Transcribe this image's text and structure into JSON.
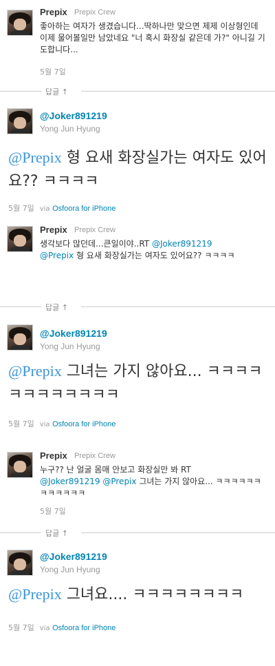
{
  "reply_label": "답글 ↑",
  "tweets": [
    {
      "name": "Prepix",
      "crew": "Prepix Crew",
      "text": "좋아하는 여자가 생겼습니다...딱하나만 맞으면 제제 이상형인데 이제 물어볼일만 남았네요 \"너 혹시 화장실 같은데 가?\" 아니길 기도합니다...",
      "date": "5월 7일"
    },
    {
      "handle": "@Joker891219",
      "fullname": "Yong Jun Hyung",
      "mention": "@Prepix",
      "text": " 형 요새 화장실가는 여자도 있어요?? ㅋㅋㅋㅋ",
      "date": "5월 7일",
      "via": "via",
      "client": "Osfoora for iPhone"
    },
    {
      "name": "Prepix",
      "crew": "Prepix Crew",
      "text_before": "생각보다 많던데...큰일이야..RT ",
      "mention1": "@Joker891219",
      "mention2": "@Prepix",
      "text_after": " 형 요새 화장실가는 여자도 있어요?? ㅋㅋㅋㅋ",
      "date": "5월 7일"
    },
    {
      "handle": "@Joker891219",
      "fullname": "Yong Jun Hyung",
      "mention": "@Prepix",
      "text": " 그녀는 가지 않아요... ㅋㅋㅋㅋㅋㅋㅋㅋㅋㅋㅋㅋ",
      "date": "5월 7일",
      "via": "via",
      "client": "Osfoora for iPhone"
    },
    {
      "name": "Prepix",
      "crew": "Prepix Crew",
      "text_before": "누구?? 난 얼굴 몸매 안보고 화장실만 봐 RT ",
      "mention1": "@Joker891219",
      "mention2": "@Prepix",
      "text_after": " 그녀는 가지 않아요... ㅋㅋㅋㅋㅋㅋㅋㅋㅋㅋㅋㅋ",
      "date": "5월 7일"
    },
    {
      "handle": "@Joker891219",
      "fullname": "Yong Jun Hyung",
      "mention": "@Prepix",
      "text": " 그녀요.... ㅋㅋㅋㅋㅋㅋㅋㅋ",
      "date": "5월 7일",
      "via": "via",
      "client": "Osfoora for iPhone"
    }
  ]
}
